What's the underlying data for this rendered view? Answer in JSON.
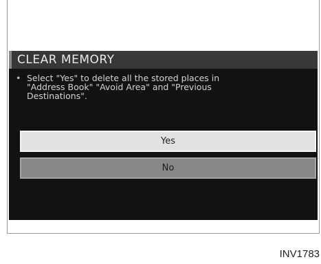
{
  "dialog": {
    "title": "CLEAR MEMORY",
    "message": "Select \"Yes\" to delete all the stored places in\n\"Address Book\" \"Avoid Area\" and \"Previous\nDestinations\".",
    "buttons": {
      "yes_label": "Yes",
      "no_label": "No"
    }
  },
  "caption": "INV1783"
}
